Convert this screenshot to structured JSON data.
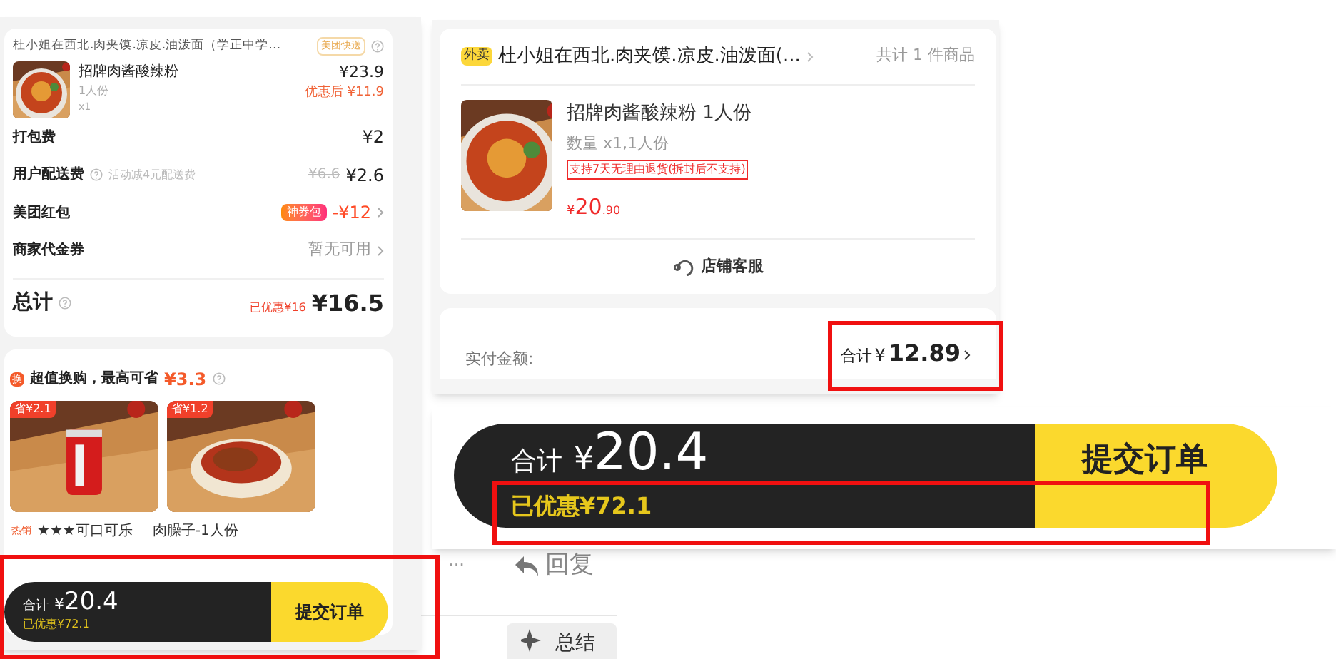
{
  "order_summary": {
    "store": "杜小姐在西北.肉夹馍.凉皮.油泼面（学正中学…",
    "delivery_badge": "美团快送",
    "item": {
      "name": "招牌肉酱酸辣粉",
      "portion": "1人份",
      "qty": "x1",
      "price": "¥23.9",
      "discounted": "优惠后 ¥11.9"
    },
    "rows": [
      {
        "kind": "plain",
        "label": "打包费",
        "value": "¥2"
      },
      {
        "kind": "fee",
        "label": "用户配送费",
        "hint": "活动减4元配送费",
        "original": "¥6.6",
        "value": "¥2.6"
      },
      {
        "kind": "coupon",
        "label": "美团红包",
        "badge": "神券包",
        "value": "-¥12"
      },
      {
        "kind": "link",
        "label": "商家代金券",
        "value": "暂无可用"
      }
    ],
    "total": {
      "label": "总计",
      "saved": "已优惠¥16",
      "currency": "¥",
      "amount": "16.5"
    }
  },
  "swap_offer": {
    "icon_text": "换",
    "title": "超值换购，最高可省",
    "amount": "¥3.3",
    "products": [
      {
        "save": "省¥2.1",
        "kind": "can"
      },
      {
        "save": "省¥1.2",
        "kind": "dish"
      }
    ],
    "hot_tag": "热销",
    "names": [
      "★★★可口可乐",
      "肉臊子-1人份"
    ]
  },
  "checkout_bar": {
    "label": "合计",
    "currency": "¥",
    "amount": "20.4",
    "saved": "已优惠¥72.1",
    "button": "提交订单"
  },
  "order_card": {
    "tag": "外卖",
    "store": "杜小姐在西北.肉夹馍.凉皮.油泼面(...",
    "count": "共计 1 件商品",
    "item": {
      "name": "招牌肉酱酸辣粉 1人份",
      "qty": "数量 x1,1人份",
      "policy": "支持7天无理由退货(拆封后不支持)",
      "currency": "¥",
      "price_int": "20",
      "price_dec": ".90"
    },
    "service": "店铺客服",
    "paid_label": "实付金额:",
    "total_label": "合计",
    "currency": "¥",
    "amount": "12.89"
  },
  "zoomed_bar": {
    "label": "合计",
    "currency": "¥",
    "amount": "20.4",
    "saved": "已优惠¥72.1",
    "button": "提交订单"
  },
  "background": {
    "more": "···",
    "reply": "回复",
    "summary": "总结"
  }
}
